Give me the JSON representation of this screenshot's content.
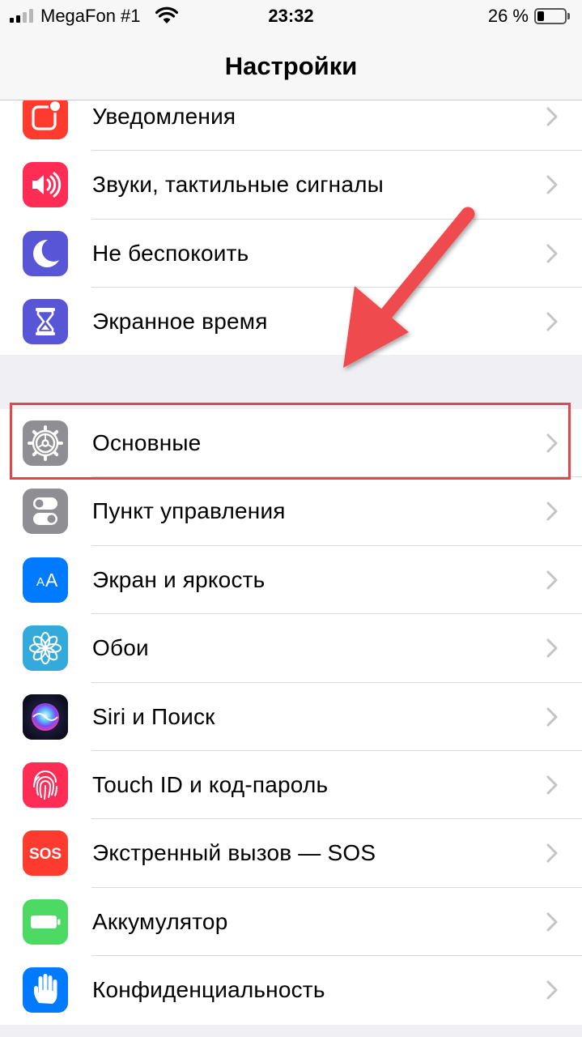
{
  "status_bar": {
    "carrier": "MegaFon #1",
    "time": "23:32",
    "battery_percent_label": "26 %",
    "battery_level": 0.26
  },
  "nav": {
    "title": "Настройки"
  },
  "groups": [
    {
      "items": [
        {
          "label": "Уведомления",
          "icon": "notifications-icon",
          "color": "#ff3b30"
        },
        {
          "label": "Звуки, тактильные сигналы",
          "icon": "sounds-icon",
          "color": "#ff2d55"
        },
        {
          "label": "Не беспокоить",
          "icon": "moon-icon",
          "color": "#5856d6"
        },
        {
          "label": "Экранное время",
          "icon": "hourglass-icon",
          "color": "#5856d6"
        }
      ]
    },
    {
      "items": [
        {
          "label": "Основные",
          "icon": "gear-icon",
          "color": "#8e8e93"
        },
        {
          "label": "Пункт управления",
          "icon": "control-center-icon",
          "color": "#8e8e93"
        },
        {
          "label": "Экран и яркость",
          "icon": "display-brightness-icon",
          "color": "#007aff"
        },
        {
          "label": "Обои",
          "icon": "wallpaper-flower-icon",
          "color": "#34aadc"
        },
        {
          "label": "Siri и Поиск",
          "icon": "siri-icon",
          "color": "#1c1c3a"
        },
        {
          "label": "Touch ID и код-пароль",
          "icon": "fingerprint-icon",
          "color": "#ff2d55"
        },
        {
          "label": "Экстренный вызов — SOS",
          "icon": "sos-icon",
          "color": "#ff3b30",
          "icon_text": "SOS"
        },
        {
          "label": "Аккумулятор",
          "icon": "battery-icon",
          "color": "#4cd964"
        },
        {
          "label": "Конфиденциальность",
          "icon": "hand-icon",
          "color": "#007aff"
        }
      ]
    }
  ],
  "annotation": {
    "highlight_color": "#e0484c",
    "highlighted_item": "Основные"
  }
}
